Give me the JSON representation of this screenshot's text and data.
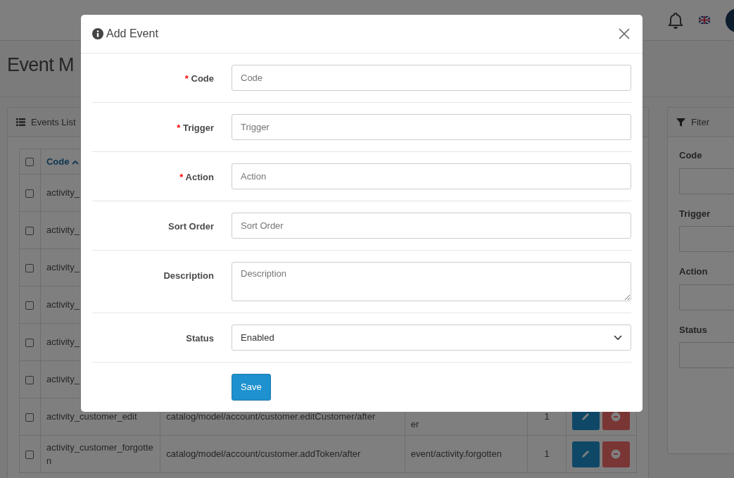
{
  "page_title": "Event M",
  "events_card": {
    "title": "Events List",
    "select_all": {
      "checked": false
    },
    "columns": [
      {
        "label": "Code",
        "sorted": true
      }
    ],
    "rows": [
      {
        "code": "activity_",
        "checked": false
      },
      {
        "code": "activity_",
        "checked": false
      },
      {
        "code": "activity_",
        "checked": false
      },
      {
        "code": "activity_",
        "checked": false
      },
      {
        "code": "activity_",
        "checked": false
      },
      {
        "code": "activity_",
        "checked": false
      },
      {
        "code": "activity_customer_edit",
        "trigger": "catalog/model/account/customer.editCustomer/after",
        "action": "er",
        "sort_order": "1",
        "checked": false
      },
      {
        "code": "activity_customer_forgotten",
        "trigger": "catalog/model/account/customer.addToken/after",
        "action": "event/activity.forgotten",
        "sort_order": "1",
        "checked": false
      }
    ]
  },
  "filter": {
    "title": "Fiter",
    "fields": [
      {
        "label": "Code"
      },
      {
        "label": "Trigger"
      },
      {
        "label": "Action"
      },
      {
        "label": "Status"
      }
    ]
  },
  "modal": {
    "title": "Add Event",
    "required_mark": "*",
    "fields": [
      {
        "label": "Code",
        "required": true,
        "kind": "input",
        "placeholder": "Code"
      },
      {
        "label": "Trigger",
        "required": true,
        "kind": "input",
        "placeholder": "Trigger"
      },
      {
        "label": "Action",
        "required": true,
        "kind": "input",
        "placeholder": "Action"
      },
      {
        "label": "Sort Order",
        "required": false,
        "kind": "input",
        "placeholder": "Sort Order"
      },
      {
        "label": "Description",
        "required": false,
        "kind": "textarea",
        "placeholder": "Description"
      },
      {
        "label": "Status",
        "required": false,
        "kind": "select",
        "value": "Enabled"
      }
    ],
    "save": "Save"
  }
}
